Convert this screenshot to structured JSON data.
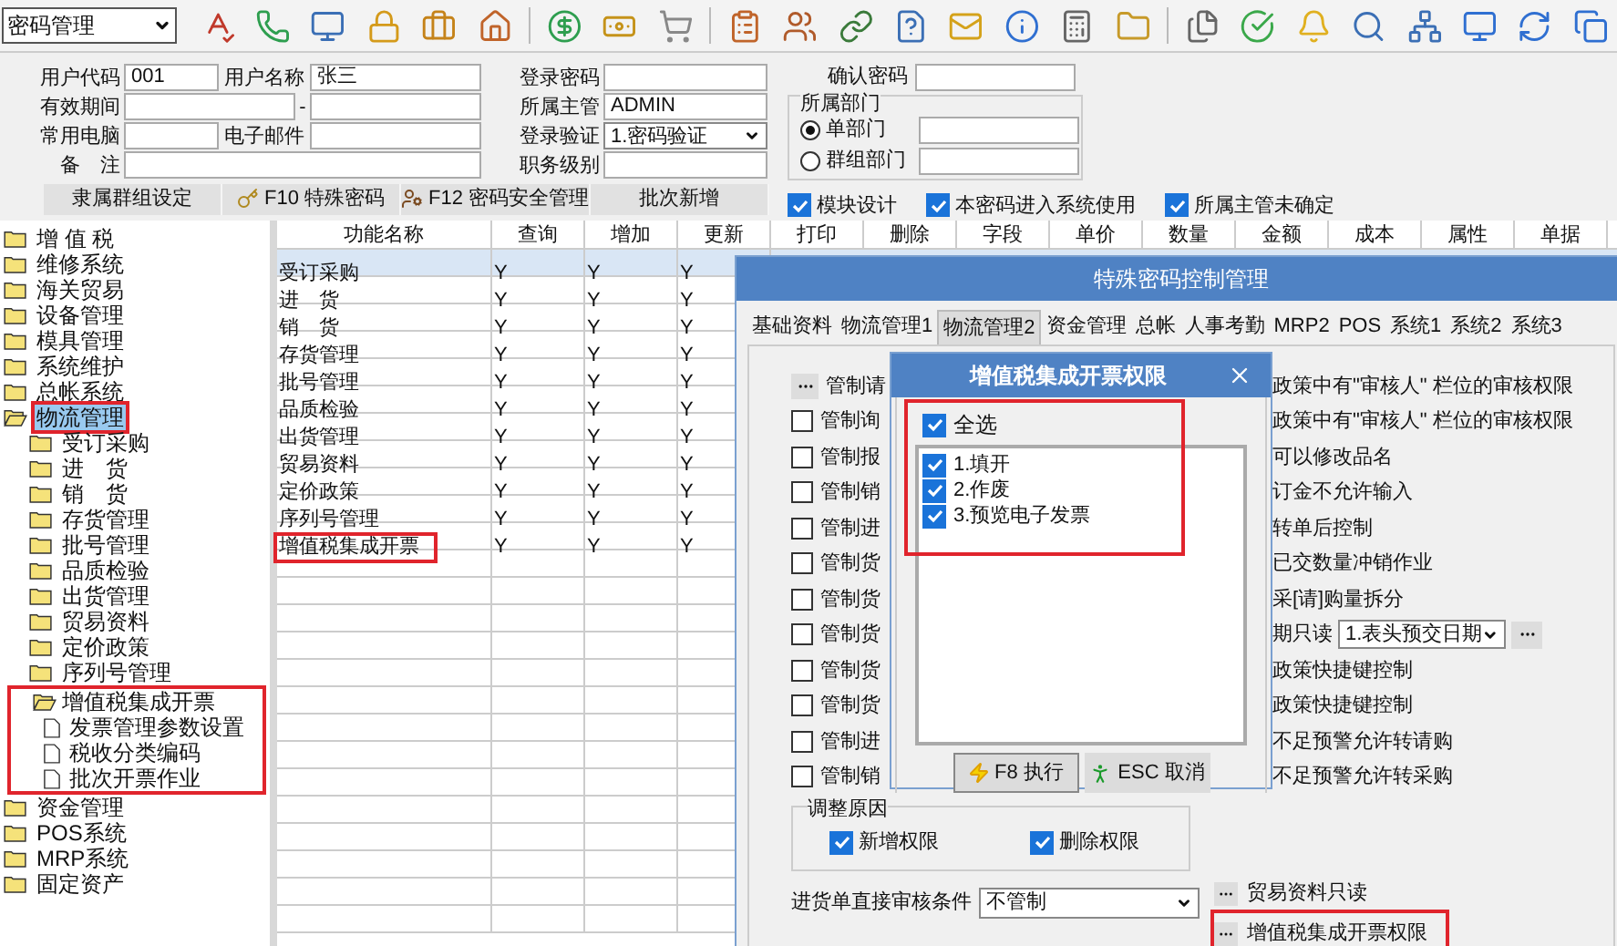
{
  "toolbar": {
    "module_select": "密码管理"
  },
  "user_form": {
    "left_rows": [
      {
        "label": "用户代码",
        "value": "001",
        "label2": "用户名称",
        "value2": "张三",
        "kind": "pair"
      },
      {
        "label": "有效期间",
        "value": "",
        "sep": "-",
        "value2": "",
        "kind": "range"
      },
      {
        "label": "常用电脑",
        "value": "",
        "label2": "电子邮件",
        "value2": "",
        "kind": "pair"
      },
      {
        "label": "备　注",
        "value": "",
        "kind": "single"
      }
    ],
    "mid_rows": [
      {
        "label": "登录密码",
        "value": "",
        "kind": "input"
      },
      {
        "label": "所属主管",
        "value": "ADMIN",
        "kind": "input"
      },
      {
        "label": "登录验证",
        "value": "1.密码验证",
        "kind": "select"
      },
      {
        "label": "职务级别",
        "value": "",
        "kind": "input"
      }
    ],
    "confirm_label": "确认密码",
    "dept_group": {
      "title": "所属部门",
      "options": [
        {
          "label": "单部门",
          "selected": true
        },
        {
          "label": "群组部门",
          "selected": false
        }
      ]
    }
  },
  "action_buttons": [
    {
      "label": "隶属群组设定",
      "kind": "plain"
    },
    {
      "label": "F10 特殊密码",
      "kind": "key"
    },
    {
      "label": "F12 密码安全管理",
      "kind": "people"
    },
    {
      "label": "批次新增",
      "kind": "plain"
    }
  ],
  "options": [
    {
      "label": "模块设计",
      "checked": true
    },
    {
      "label": "本密码进入系统使用",
      "checked": true
    },
    {
      "label": "所属主管未确定",
      "checked": true
    }
  ],
  "tree": [
    {
      "label": "增 值 税",
      "kind": "folder",
      "expanded": false,
      "selected": false,
      "highlighted": false
    },
    {
      "label": "维修系统",
      "kind": "folder",
      "expanded": false,
      "selected": false,
      "highlighted": false
    },
    {
      "label": "海关贸易",
      "kind": "folder",
      "expanded": false,
      "selected": false,
      "highlighted": false
    },
    {
      "label": "设备管理",
      "kind": "folder",
      "expanded": false,
      "selected": false,
      "highlighted": false
    },
    {
      "label": "模具管理",
      "kind": "folder",
      "expanded": false,
      "selected": false,
      "highlighted": false
    },
    {
      "label": "系统维护",
      "kind": "folder",
      "expanded": false,
      "selected": false,
      "highlighted": false
    },
    {
      "label": "总帐系统",
      "kind": "folder",
      "expanded": false,
      "selected": false,
      "highlighted": false
    },
    {
      "label": "物流管理",
      "kind": "folder",
      "expanded": true,
      "selected": true,
      "highlighted": true,
      "children": [
        {
          "label": "受订采购",
          "kind": "folder",
          "expanded": false,
          "selected": false,
          "highlighted": false
        },
        {
          "label": "进　货",
          "kind": "folder",
          "expanded": false,
          "selected": false,
          "highlighted": false
        },
        {
          "label": "销　货",
          "kind": "folder",
          "expanded": false,
          "selected": false,
          "highlighted": false
        },
        {
          "label": "存货管理",
          "kind": "folder",
          "expanded": false,
          "selected": false,
          "highlighted": false
        },
        {
          "label": "批号管理",
          "kind": "folder",
          "expanded": false,
          "selected": false,
          "highlighted": false
        },
        {
          "label": "品质检验",
          "kind": "folder",
          "expanded": false,
          "selected": false,
          "highlighted": false
        },
        {
          "label": "出货管理",
          "kind": "folder",
          "expanded": false,
          "selected": false,
          "highlighted": false
        },
        {
          "label": "贸易资料",
          "kind": "folder",
          "expanded": false,
          "selected": false,
          "highlighted": false
        },
        {
          "label": "定价政策",
          "kind": "folder",
          "expanded": false,
          "selected": false,
          "highlighted": false
        },
        {
          "label": "序列号管理",
          "kind": "folder",
          "expanded": false,
          "selected": false,
          "highlighted": false
        },
        {
          "label": "增值税集成开票",
          "kind": "folder",
          "expanded": true,
          "selected": false,
          "highlighted": true,
          "children": [
            {
              "label": "发票管理参数设置",
              "kind": "doc",
              "selected": false,
              "highlighted": false
            },
            {
              "label": "税收分类编码",
              "kind": "doc",
              "selected": false,
              "highlighted": false
            },
            {
              "label": "批次开票作业",
              "kind": "doc",
              "selected": false,
              "highlighted": false
            }
          ]
        }
      ]
    },
    {
      "label": "资金管理",
      "kind": "folder",
      "expanded": false,
      "selected": false,
      "highlighted": false
    },
    {
      "label": "POS系统",
      "kind": "folder",
      "expanded": false,
      "selected": false,
      "highlighted": false
    },
    {
      "label": "MRP系统",
      "kind": "folder",
      "expanded": false,
      "selected": false,
      "highlighted": false
    },
    {
      "label": "固定资产",
      "kind": "folder",
      "expanded": false,
      "selected": false,
      "highlighted": false
    }
  ],
  "table": {
    "columns": [
      "功能名称",
      "查询",
      "增加",
      "更新",
      "打印",
      "删除",
      "字段",
      "单价",
      "数量",
      "金额",
      "成本",
      "属性",
      "单据"
    ],
    "rows": [
      {
        "cells": [
          "受订采购",
          "Y",
          "Y",
          "Y"
        ],
        "selected": true,
        "highlighted": false
      },
      {
        "cells": [
          "进　货",
          "Y",
          "Y",
          "Y"
        ],
        "selected": false,
        "highlighted": false
      },
      {
        "cells": [
          "销　货",
          "Y",
          "Y",
          "Y"
        ],
        "selected": false,
        "highlighted": false
      },
      {
        "cells": [
          "存货管理",
          "Y",
          "Y",
          "Y"
        ],
        "selected": false,
        "highlighted": false
      },
      {
        "cells": [
          "批号管理",
          "Y",
          "Y",
          "Y"
        ],
        "selected": false,
        "highlighted": false
      },
      {
        "cells": [
          "品质检验",
          "Y",
          "Y",
          "Y"
        ],
        "selected": false,
        "highlighted": false
      },
      {
        "cells": [
          "出货管理",
          "Y",
          "Y",
          "Y"
        ],
        "selected": false,
        "highlighted": false
      },
      {
        "cells": [
          "贸易资料",
          "Y",
          "Y",
          "Y"
        ],
        "selected": false,
        "highlighted": false
      },
      {
        "cells": [
          "定价政策",
          "Y",
          "Y",
          "Y"
        ],
        "selected": false,
        "highlighted": false
      },
      {
        "cells": [
          "序列号管理",
          "Y",
          "Y",
          "Y"
        ],
        "selected": false,
        "highlighted": false
      },
      {
        "cells": [
          "增值税集成开票",
          "Y",
          "Y",
          "Y"
        ],
        "selected": false,
        "highlighted": true
      }
    ]
  },
  "dialog": {
    "title": "特殊密码控制管理",
    "tabs": [
      {
        "label": "基础资料",
        "selected": false
      },
      {
        "label": "物流管理1",
        "selected": false
      },
      {
        "label": "物流管理2",
        "selected": true
      },
      {
        "label": "资金管理",
        "selected": false
      },
      {
        "label": "总帐",
        "selected": false
      },
      {
        "label": "人事考勤",
        "selected": false
      },
      {
        "label": "MRP2",
        "selected": false
      },
      {
        "label": "POS",
        "selected": false
      },
      {
        "label": "系统1",
        "selected": false
      },
      {
        "label": "系统2",
        "selected": false
      },
      {
        "label": "系统3",
        "selected": false
      }
    ],
    "rows": [
      {
        "left": {
          "kind": "button",
          "label": "管制请"
        },
        "right": {
          "kind": "text",
          "text": "政策中有\"审核人\" 栏位的审核权限"
        }
      },
      {
        "left": {
          "kind": "checkbox",
          "label": "管制询",
          "checked": false
        },
        "right": {
          "kind": "text",
          "text": "政策中有\"审核人\" 栏位的审核权限"
        }
      },
      {
        "left": {
          "kind": "checkbox",
          "label": "管制报",
          "checked": false
        },
        "right": {
          "kind": "text",
          "text": "可以修改品名"
        }
      },
      {
        "left": {
          "kind": "checkbox",
          "label": "管制销",
          "checked": false
        },
        "right": {
          "kind": "text",
          "text": "订金不允许输入"
        }
      },
      {
        "left": {
          "kind": "checkbox",
          "label": "管制进",
          "checked": false
        },
        "right": {
          "kind": "text",
          "text": "转单后控制"
        }
      },
      {
        "left": {
          "kind": "checkbox",
          "label": "管制货",
          "checked": false
        },
        "right": {
          "kind": "text",
          "text": "已交数量冲销作业"
        }
      },
      {
        "left": {
          "kind": "checkbox",
          "label": "管制货",
          "checked": false
        },
        "right": {
          "kind": "text",
          "text": "采[请]购量拆分"
        }
      },
      {
        "left": {
          "kind": "checkbox",
          "label": "管制货",
          "checked": false
        },
        "right": {
          "kind": "select",
          "text": "期只读",
          "value": "1.表头预交日期"
        }
      },
      {
        "left": {
          "kind": "checkbox",
          "label": "管制货",
          "checked": false
        },
        "right": {
          "kind": "text",
          "text": "政策快捷键控制"
        }
      },
      {
        "left": {
          "kind": "checkbox",
          "label": "管制货",
          "checked": false
        },
        "right": {
          "kind": "text",
          "text": "政策快捷键控制"
        }
      },
      {
        "left": {
          "kind": "checkbox",
          "label": "管制进",
          "checked": false
        },
        "right": {
          "kind": "text",
          "text": "不足预警允许转请购"
        }
      },
      {
        "left": {
          "kind": "checkbox",
          "label": "管制销",
          "checked": false
        },
        "right": {
          "kind": "text",
          "text": "不足预警允许转采购"
        }
      }
    ],
    "adjust_reason": {
      "title": "调整原因",
      "options": [
        {
          "label": "新增权限",
          "checked": true
        },
        {
          "label": "删除权限",
          "checked": true
        }
      ]
    },
    "audit_condition": {
      "label": "进货单直接审核条件",
      "value": "不管制"
    },
    "link_buttons": [
      {
        "label": "贸易资料只读",
        "highlighted": false
      },
      {
        "label": "增值税集成开票权限",
        "highlighted": true
      }
    ]
  },
  "popup": {
    "title": "增值税集成开票权限",
    "select_all": {
      "label": "全选",
      "checked": true
    },
    "items": [
      {
        "label": "1.填开",
        "checked": true
      },
      {
        "label": "2.作废",
        "checked": true
      },
      {
        "label": "3.预览电子发票",
        "checked": true
      }
    ],
    "highlighted": true,
    "buttons": [
      {
        "label": "F8 执行",
        "kind": "run"
      },
      {
        "label": "ESC 取消",
        "kind": "cancel"
      }
    ]
  }
}
